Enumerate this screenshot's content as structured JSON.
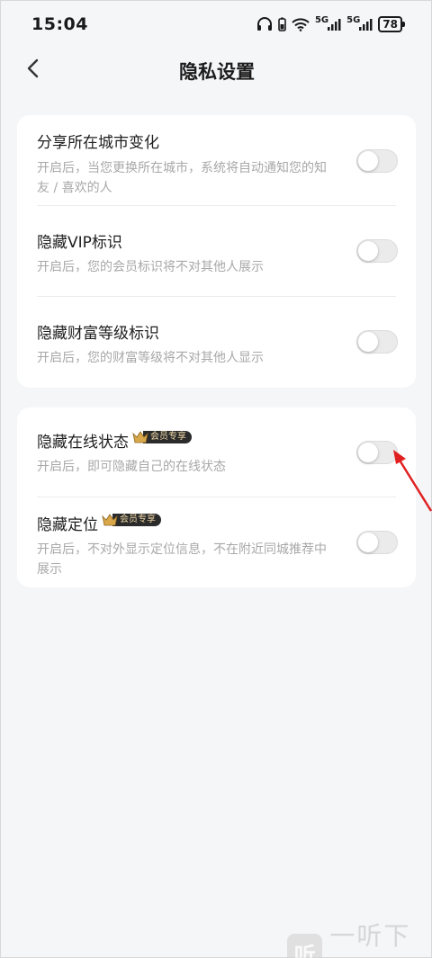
{
  "status_bar": {
    "time": "15:04",
    "network_1": "5G",
    "network_2": "5G",
    "battery": "78",
    "icons": [
      "headphones-icon",
      "battery-saver-icon",
      "wifi-icon",
      "signal-icon",
      "signal-icon",
      "battery-icon"
    ]
  },
  "header": {
    "title": "隐私设置",
    "back_icon": "chevron-left-icon"
  },
  "settings_group_1": [
    {
      "title": "分享所在城市变化",
      "desc": "开启后，当您更换所在城市，系统将自动通知您的知友 / 喜欢的人",
      "enabled": false
    },
    {
      "title": "隐藏VIP标识",
      "desc": "开启后，您的会员标识将不对其他人展示",
      "enabled": false
    },
    {
      "title": "隐藏财富等级标识",
      "desc": "开启后，您的财富等级将不对其他人显示",
      "enabled": false
    }
  ],
  "settings_group_2": [
    {
      "title": "隐藏在线状态",
      "badge": "会员专享",
      "desc": "开启后，即可隐藏自己的在线状态",
      "enabled": false
    },
    {
      "title": "隐藏定位",
      "badge": "会员专享",
      "desc": "开启后，不对外显示定位信息，不在附近同城推荐中展示",
      "enabled": false
    }
  ],
  "colors": {
    "background": "#f5f6f8",
    "card": "#ffffff",
    "desc_text": "#a8a8a8",
    "toggle_off": "#ebebeb",
    "badge_bg": "#2b2b2b",
    "badge_text": "#f0d9a8",
    "annotation_arrow": "#e02020"
  },
  "watermark": {
    "logo": "听",
    "text": "一听下载"
  }
}
